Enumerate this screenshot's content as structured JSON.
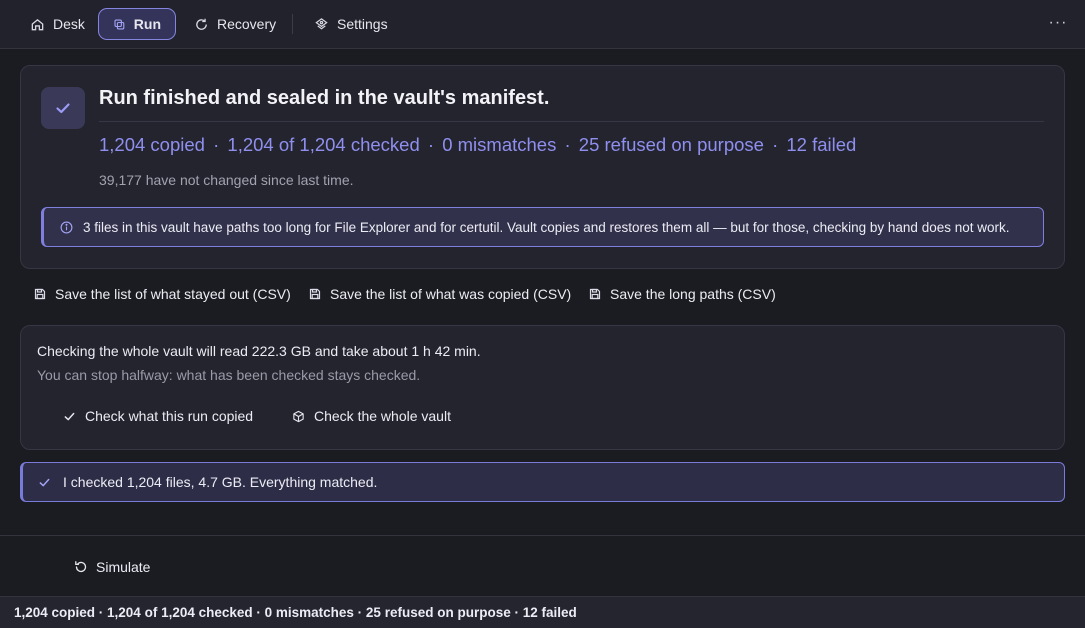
{
  "nav": {
    "tabs": [
      {
        "label": "Desk",
        "icon": "home-icon"
      },
      {
        "label": "Run",
        "icon": "copy-icon",
        "active": true
      },
      {
        "label": "Recovery",
        "icon": "refresh-icon"
      },
      {
        "label": "Settings",
        "icon": "settings-icon"
      }
    ],
    "more_label": "···"
  },
  "summary": {
    "title": "Run finished and sealed in the vault's manifest.",
    "stats": [
      "1,204 copied",
      "1,204 of 1,204 checked",
      "0 mismatches",
      "25 refused on purpose",
      "12 failed"
    ],
    "separator": "·",
    "unchanged": "39,177 have not changed since last time.",
    "notice": "3 files in this vault have paths too long for File Explorer and for certutil. Vault copies and restores them all — but for those, checking by hand does not work."
  },
  "exports": [
    "Save the list of what stayed out (CSV)",
    "Save the list of what was copied (CSV)",
    "Save the long paths (CSV)"
  ],
  "verify": {
    "info": "Checking the whole vault will read 222.3 GB and take about 1 h 42 min.",
    "sub": "You can stop halfway: what has been checked stays checked.",
    "check_run_label": "Check what this run copied",
    "check_vault_label": "Check the whole vault"
  },
  "result": {
    "text": "I checked 1,204 files, 4.7 GB. Everything matched."
  },
  "simulate_label": "Simulate",
  "statusbar": {
    "text": "1,204 copied · 1,204 of 1,204 checked · 0 mismatches · 25 refused on purpose · 12 failed"
  },
  "colors": {
    "accent": "#8f8ff0",
    "background": "#1b1b22",
    "card": "#24242e"
  }
}
